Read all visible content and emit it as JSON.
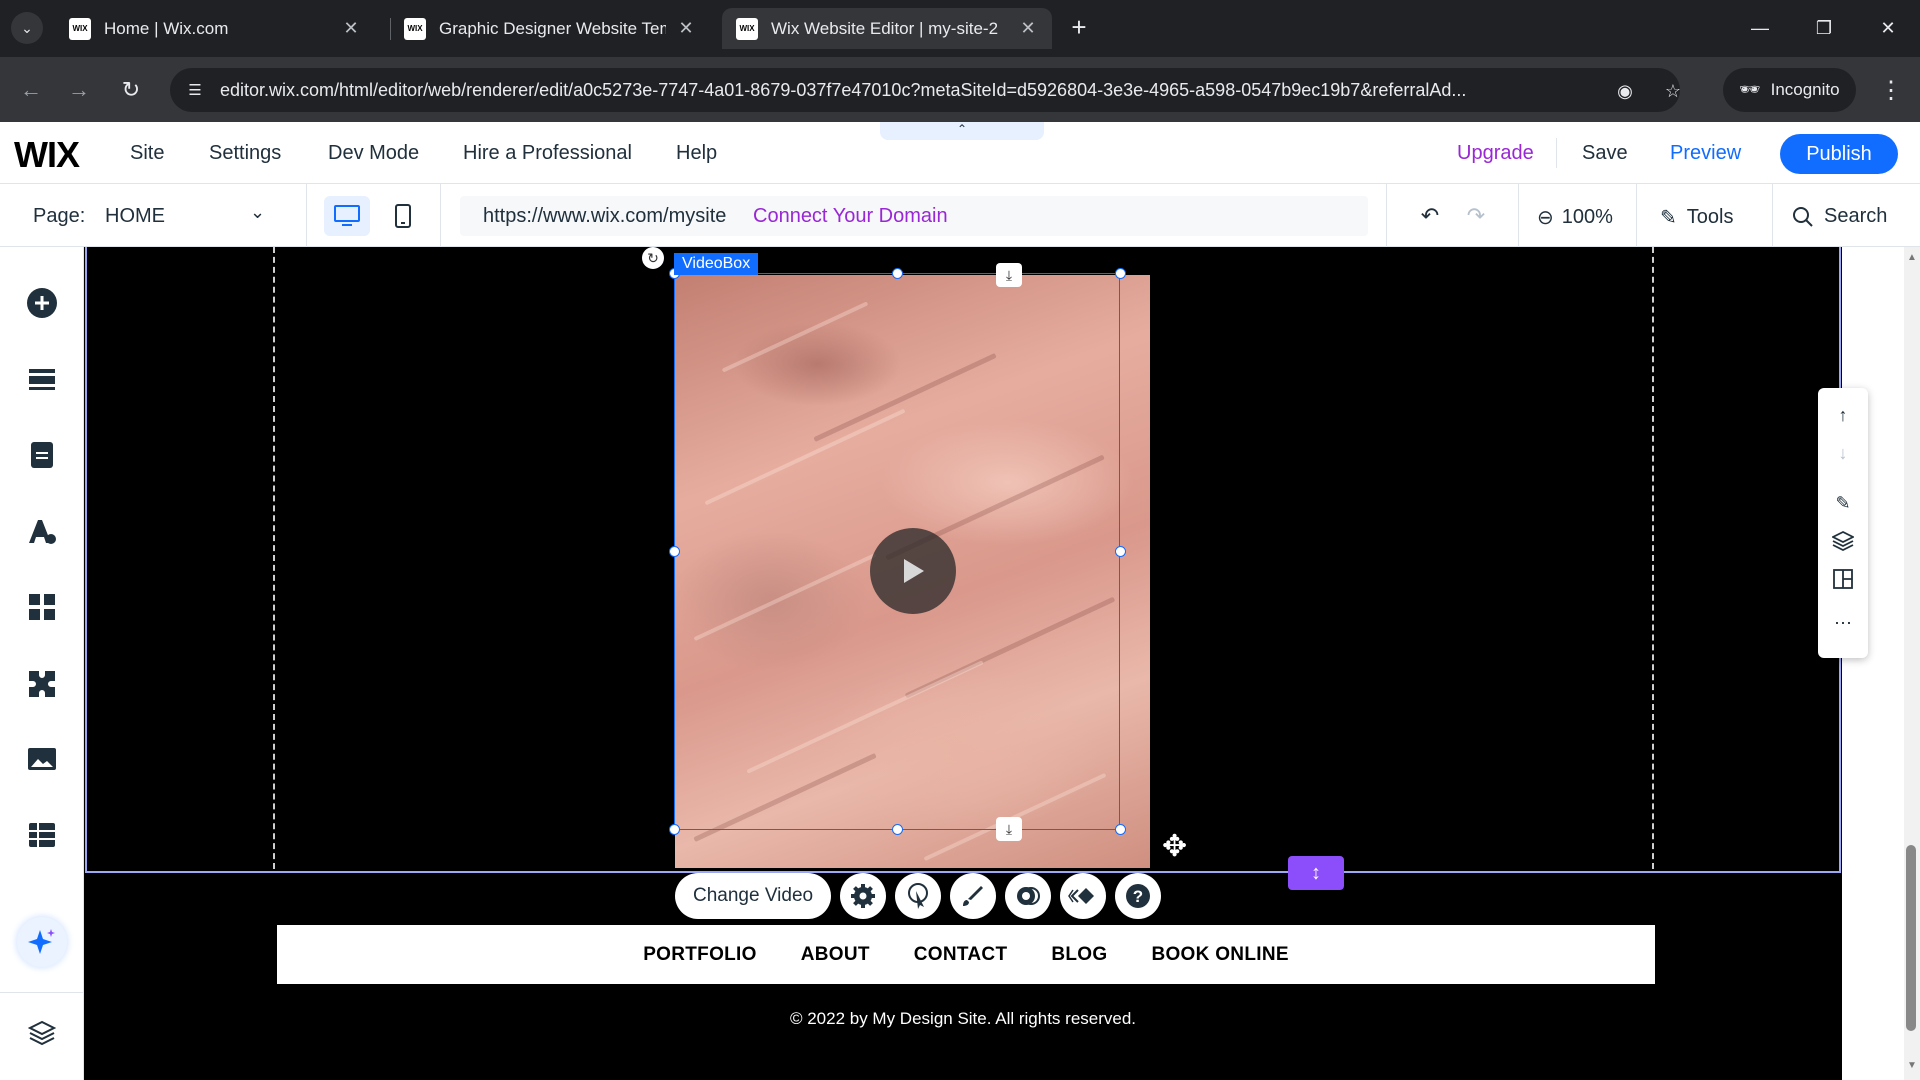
{
  "browser": {
    "tabs": [
      {
        "title": "Home | Wix.com",
        "favicon": "WIX",
        "active": false
      },
      {
        "title": "Graphic Designer Website Tem",
        "favicon": "WIX",
        "active": false
      },
      {
        "title": "Wix Website Editor | my-site-2",
        "favicon": "WIX",
        "active": true
      }
    ],
    "url": "editor.wix.com/html/editor/web/renderer/edit/a0c5273e-7747-4a01-8679-037f7e47010c?metaSiteId=d5926804-3e3e-4965-a598-0547b9ec19b7&referralAd...",
    "incognito_label": "Incognito"
  },
  "wix": {
    "logo": "WIX",
    "menu": [
      "Site",
      "Settings",
      "Dev Mode",
      "Hire a Professional",
      "Help"
    ],
    "upgrade": "Upgrade",
    "save": "Save",
    "preview": "Preview",
    "publish": "Publish",
    "page_label": "Page:",
    "page_value": "HOME",
    "site_url": "https://www.wix.com/mysite",
    "connect_domain": "Connect Your Domain",
    "zoom": "100%",
    "tools": "Tools",
    "search": "Search"
  },
  "canvas": {
    "selection_label": "VideoBox",
    "change_video": "Change Video",
    "site_nav": [
      "PORTFOLIO",
      "ABOUT",
      "CONTACT",
      "BLOG",
      "BOOK ONLINE"
    ],
    "footer": "© 2022 by My Design Site. All rights reserved."
  },
  "colors": {
    "accent": "#116dff",
    "upgrade": "#9a27d5",
    "stretch": "#8c4dfa"
  }
}
